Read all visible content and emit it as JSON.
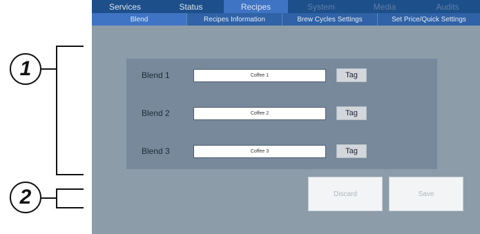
{
  "callouts": [
    "1",
    "2"
  ],
  "main_tabs": [
    {
      "label": "Services",
      "state": "normal"
    },
    {
      "label": "Status",
      "state": "normal"
    },
    {
      "label": "Recipes",
      "state": "active"
    },
    {
      "label": "System",
      "state": "disabled"
    },
    {
      "label": "Media",
      "state": "disabled"
    },
    {
      "label": "Audits",
      "state": "disabled"
    }
  ],
  "sub_tabs": [
    {
      "label": "Blend",
      "state": "active"
    },
    {
      "label": "Recipes Information",
      "state": "normal"
    },
    {
      "label": "Brew Cycles Settings",
      "state": "normal"
    },
    {
      "label": "Set Price/Quick Settings",
      "state": "normal"
    }
  ],
  "blends": [
    {
      "label": "Blend 1",
      "value": "Coffee 1",
      "tag": "Tag"
    },
    {
      "label": "Blend 2",
      "value": "Coffee 2",
      "tag": "Tag"
    },
    {
      "label": "Blend 3",
      "value": "Coffee 3",
      "tag": "Tag"
    }
  ],
  "actions": {
    "discard": "Discard",
    "save": "Save"
  },
  "colors": {
    "tab_bar": "#1d4f8a",
    "active_tab": "#3f74c4",
    "screen_bg": "#8d9ca9",
    "panel_bg": "#77899b"
  }
}
